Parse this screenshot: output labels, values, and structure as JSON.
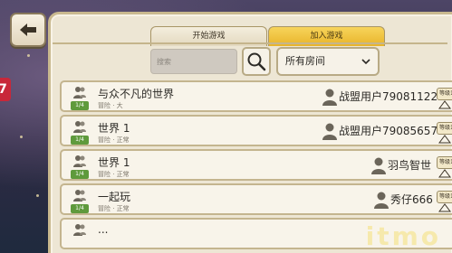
{
  "header": {
    "back_icon": "arrow-left-icon",
    "tabs": [
      {
        "label": "开始游戏",
        "active": false
      },
      {
        "label": "加入游戏",
        "active": true
      }
    ]
  },
  "toolbar": {
    "search_placeholder": "搜索",
    "search_icon": "magnifier-icon",
    "room_filter": "所有房间",
    "room_filter_icon": "chevron-down-icon"
  },
  "rooms": [
    {
      "name": "与众不凡的世界",
      "players": "1/4",
      "mode": "冒险 · 大",
      "host": "战盟用户79081122",
      "level_label": "等级1"
    },
    {
      "name": "世界 1",
      "players": "1/4",
      "mode": "冒险 · 正常",
      "host": "战盟用户79085657",
      "level_label": "等级1"
    },
    {
      "name": "世界 1",
      "players": "1/4",
      "mode": "冒险 · 正常",
      "host": "羽鸟智世",
      "level_label": "等级1"
    },
    {
      "name": "一起玩",
      "players": "1/4",
      "mode": "冒险 · 正常",
      "host": "秀仔666",
      "level_label": "等级1"
    },
    {
      "name": "...",
      "players": "1/4",
      "mode": "",
      "host": "",
      "level_label": ""
    }
  ],
  "watermark": "itmo",
  "colors": {
    "active_tab": "#e8b42a",
    "player_badge": "#5f9a3c",
    "panel_bg": "#ede6d4",
    "panel_border": "#c9b98f"
  }
}
